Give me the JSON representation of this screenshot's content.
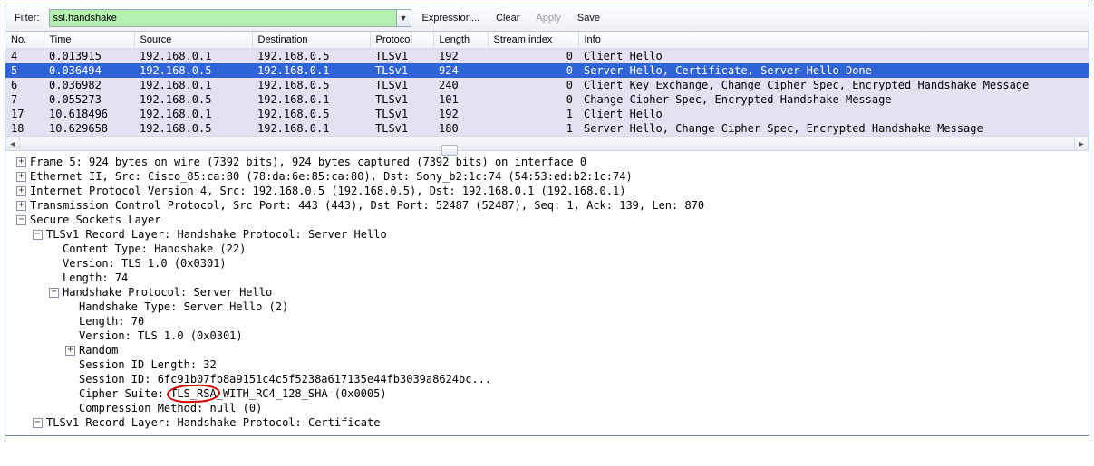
{
  "toolbar": {
    "filter_label": "Filter:",
    "filter_value": "ssl.handshake",
    "expression": "Expression...",
    "clear": "Clear",
    "apply": "Apply",
    "save": "Save"
  },
  "columns": {
    "no": "No.",
    "time": "Time",
    "source": "Source",
    "destination": "Destination",
    "protocol": "Protocol",
    "length": "Length",
    "stream": "Stream index",
    "info": "Info"
  },
  "packets": [
    {
      "no": "4",
      "time": "0.013915",
      "src": "192.168.0.1",
      "dst": "192.168.0.5",
      "proto": "TLSv1",
      "len": "192",
      "stream": "0",
      "info": "Client Hello",
      "cls": "alt"
    },
    {
      "no": "5",
      "time": "0.036494",
      "src": "192.168.0.5",
      "dst": "192.168.0.1",
      "proto": "TLSv1",
      "len": "924",
      "stream": "0",
      "info": "Server Hello, Certificate, Server Hello Done",
      "cls": "sel"
    },
    {
      "no": "6",
      "time": "0.036982",
      "src": "192.168.0.1",
      "dst": "192.168.0.5",
      "proto": "TLSv1",
      "len": "240",
      "stream": "0",
      "info": "Client Key Exchange, Change Cipher Spec, Encrypted Handshake Message",
      "cls": "alt"
    },
    {
      "no": "7",
      "time": "0.055273",
      "src": "192.168.0.5",
      "dst": "192.168.0.1",
      "proto": "TLSv1",
      "len": "101",
      "stream": "0",
      "info": "Change Cipher Spec, Encrypted Handshake Message",
      "cls": "alt"
    },
    {
      "no": "17",
      "time": "10.618496",
      "src": "192.168.0.1",
      "dst": "192.168.0.5",
      "proto": "TLSv1",
      "len": "192",
      "stream": "1",
      "info": "Client Hello",
      "cls": "alt"
    },
    {
      "no": "18",
      "time": "10.629658",
      "src": "192.168.0.5",
      "dst": "192.168.0.1",
      "proto": "TLSv1",
      "len": "180",
      "stream": "1",
      "info": "Server Hello, Change Cipher Spec, Encrypted Handshake Message",
      "cls": "alt"
    }
  ],
  "details": [
    {
      "indent": 0,
      "exp": "+",
      "text": "Frame 5: 924 bytes on wire (7392 bits), 924 bytes captured (7392 bits) on interface 0"
    },
    {
      "indent": 0,
      "exp": "+",
      "text": "Ethernet II, Src: Cisco_85:ca:80 (78:da:6e:85:ca:80), Dst: Sony_b2:1c:74 (54:53:ed:b2:1c:74)"
    },
    {
      "indent": 0,
      "exp": "+",
      "text": "Internet Protocol Version 4, Src: 192.168.0.5 (192.168.0.5), Dst: 192.168.0.1 (192.168.0.1)"
    },
    {
      "indent": 0,
      "exp": "+",
      "text": "Transmission Control Protocol, Src Port: 443 (443), Dst Port: 52487 (52487), Seq: 1, Ack: 139, Len: 870"
    },
    {
      "indent": 0,
      "exp": "-",
      "text": "Secure Sockets Layer"
    },
    {
      "indent": 1,
      "exp": "-",
      "text": "TLSv1 Record Layer: Handshake Protocol: Server Hello"
    },
    {
      "indent": 2,
      "exp": "",
      "text": "Content Type: Handshake (22)"
    },
    {
      "indent": 2,
      "exp": "",
      "text": "Version: TLS 1.0 (0x0301)"
    },
    {
      "indent": 2,
      "exp": "",
      "text": "Length: 74"
    },
    {
      "indent": 2,
      "exp": "-",
      "text": "Handshake Protocol: Server Hello"
    },
    {
      "indent": 3,
      "exp": "",
      "text": "Handshake Type: Server Hello (2)"
    },
    {
      "indent": 3,
      "exp": "",
      "text": "Length: 70"
    },
    {
      "indent": 3,
      "exp": "",
      "text": "Version: TLS 1.0 (0x0301)"
    },
    {
      "indent": 3,
      "exp": "+",
      "text": "Random"
    },
    {
      "indent": 3,
      "exp": "",
      "text": "Session ID Length: 32"
    },
    {
      "indent": 3,
      "exp": "",
      "text": "Session ID: 6fc91b07fb8a9151c4c5f5238a617135e44fb3039a8624bc..."
    },
    {
      "indent": 3,
      "exp": "",
      "text": "Cipher Suite: ",
      "circ": "TLS_RSA",
      "after": "_WITH_RC4_128_SHA (0x0005)"
    },
    {
      "indent": 3,
      "exp": "",
      "text": "Compression Method: null (0)"
    },
    {
      "indent": 1,
      "exp": "-",
      "text": "TLSv1 Record Layer: Handshake Protocol: Certificate"
    }
  ]
}
